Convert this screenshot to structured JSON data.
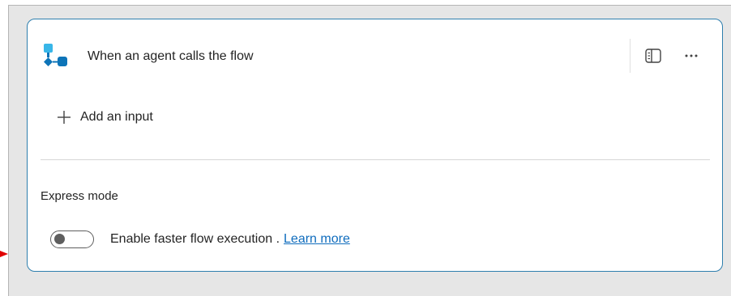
{
  "card": {
    "title": "When an agent calls the flow",
    "trigger_icon": "agent-flow-trigger-icon",
    "header_actions": [
      {
        "icon": "side-panel-icon"
      },
      {
        "icon": "more-options-icon"
      }
    ]
  },
  "inputs": {
    "add_label": "Add an input",
    "add_icon": "plus-icon"
  },
  "express_mode": {
    "title": "Express mode",
    "toggle_on": false,
    "toggle_label": "Enable faster flow execution .",
    "learn_more_label": "Learn more"
  },
  "colors": {
    "card_border": "#2e7fae",
    "canvas_background": "#e6e6e6",
    "link": "#0f6cbd",
    "icon_primary": "#0d74b8",
    "icon_secondary": "#38b6e8",
    "indicator_arrow": "#e00000"
  }
}
